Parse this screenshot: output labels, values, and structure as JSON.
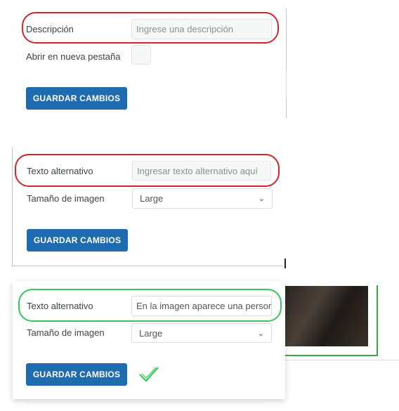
{
  "panel1": {
    "description_label": "Descripción",
    "description_placeholder": "Ingrese una descripción",
    "new_tab_label": "Abrir en nueva pestaña",
    "save_label": "GUARDAR CAMBIOS"
  },
  "panel2": {
    "alt_text_label": "Texto alternativo",
    "alt_text_placeholder": "Ingresar texto alternativo aquí",
    "image_size_label": "Tamaño de imagen",
    "image_size_value": "Large",
    "save_label": "GUARDAR CAMBIOS"
  },
  "panel3": {
    "alt_text_label": "Texto alternativo",
    "alt_text_value": "En la imagen aparece una persor",
    "image_size_label": "Tamaño de imagen",
    "image_size_value": "Large",
    "save_label": "GUARDAR CAMBIOS"
  },
  "colors": {
    "button": "#1e6bb0",
    "highlight_error": "#d8232a",
    "highlight_success": "#34c759"
  },
  "icons": [
    "chevron-down-icon",
    "checkmark-icon"
  ]
}
